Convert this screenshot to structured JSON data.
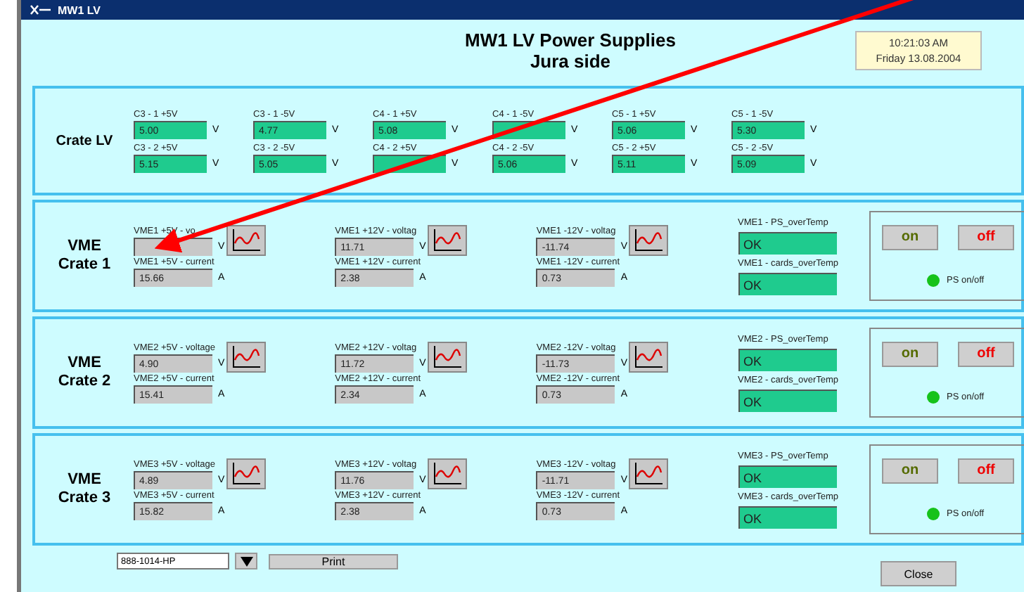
{
  "window": {
    "title": "MW1 LV"
  },
  "header": {
    "title": "MW1 LV Power Supplies",
    "subtitle": "Jura side",
    "time": "10:21:03 AM",
    "date": "Friday 13.08.2004"
  },
  "crate_lv": {
    "label": "Crate LV",
    "channels": [
      {
        "label": "C3 - 1 +5V",
        "value": "5.00",
        "unit": "V"
      },
      {
        "label": "C3 - 1 -5V",
        "value": "4.77",
        "unit": "V"
      },
      {
        "label": "C4 - 1 +5V",
        "value": "5.08",
        "unit": "V"
      },
      {
        "label": "C4 - 1 -5V",
        "unit": "V"
      },
      {
        "label": "C5 - 1 +5V",
        "value": "5.06",
        "unit": "V"
      },
      {
        "label": "C5 - 1 -5V",
        "value": "5.30",
        "unit": "V"
      },
      {
        "label": "C3 - 2 +5V",
        "value": "5.15",
        "unit": "V"
      },
      {
        "label": "C3 - 2 -5V",
        "value": "5.05",
        "unit": "V"
      },
      {
        "label": "C4 - 2 +5V",
        "unit": "V"
      },
      {
        "label": "C4 - 2 -5V",
        "value": "5.06",
        "unit": "V"
      },
      {
        "label": "C5 - 2 +5V",
        "value": "5.11",
        "unit": "V"
      },
      {
        "label": "C5 - 2 -5V",
        "value": "5.09",
        "unit": "V"
      }
    ]
  },
  "vme_crates": [
    {
      "label": "VME",
      "number": "Crate 1",
      "supplies": [
        {
          "voltage_label": "VME1 +5V - vo",
          "voltage_unit": "V",
          "current_label": "VME1 +5V - current",
          "current": "15.66",
          "current_unit": "A"
        },
        {
          "voltage_label": "VME1 +12V - voltag",
          "voltage": "11.71",
          "voltage_unit": "V",
          "current_label": "VME1 +12V - current",
          "current": "2.38",
          "current_unit": "A"
        },
        {
          "voltage_label": "VME1 -12V - voltag",
          "voltage": "-11.74",
          "voltage_unit": "V",
          "current_label": "VME1 -12V - current",
          "current": "0.73",
          "current_unit": "A"
        }
      ],
      "status": [
        {
          "label": "VME1 - PS_overTemp",
          "value": "OK"
        },
        {
          "label": "VME1 - cards_overTemp",
          "value": "OK"
        }
      ],
      "on_button": "on",
      "off_button": "off",
      "led_label": "PS on/off",
      "led_on": true
    },
    {
      "label": "VME",
      "number": "Crate 2",
      "supplies": [
        {
          "voltage_label": "VME2 +5V - voltage",
          "voltage": "4.90",
          "voltage_unit": "V",
          "current_label": "VME2 +5V - current",
          "current": "15.41",
          "current_unit": "A"
        },
        {
          "voltage_label": "VME2 +12V - voltag",
          "voltage": "11.72",
          "voltage_unit": "V",
          "current_label": "VME2 +12V - current",
          "current": "2.34",
          "current_unit": "A"
        },
        {
          "voltage_label": "VME2 -12V - voltag",
          "voltage": "-11.73",
          "voltage_unit": "V",
          "current_label": "VME2 -12V - current",
          "current": "0.73",
          "current_unit": "A"
        }
      ],
      "status": [
        {
          "label": "VME2 - PS_overTemp",
          "value": "OK"
        },
        {
          "label": "VME2 - cards_overTemp",
          "value": "OK"
        }
      ],
      "on_button": "on",
      "off_button": "off",
      "led_label": "PS on/off",
      "led_on": true
    },
    {
      "label": "VME",
      "number": "Crate 3",
      "supplies": [
        {
          "voltage_label": "VME3 +5V - voltage",
          "voltage": "4.89",
          "voltage_unit": "V",
          "current_label": "VME3 +5V - current",
          "current": "15.82",
          "current_unit": "A"
        },
        {
          "voltage_label": "VME3 +12V - voltag",
          "voltage": "11.76",
          "voltage_unit": "V",
          "current_label": "VME3 +12V - current",
          "current": "2.38",
          "current_unit": "A"
        },
        {
          "voltage_label": "VME3 -12V - voltag",
          "voltage": "-11.71",
          "voltage_unit": "V",
          "current_label": "VME3 -12V - current",
          "current": "0.73",
          "current_unit": "A"
        }
      ],
      "status": [
        {
          "label": "VME3 - PS_overTemp",
          "value": "OK"
        },
        {
          "label": "VME3 - cards_overTemp",
          "value": "OK"
        }
      ],
      "on_button": "on",
      "off_button": "off",
      "led_label": "PS on/off",
      "led_on": true
    }
  ],
  "footer": {
    "printer": "888-1014-HP",
    "print_button": "Print",
    "close_button": "Close"
  }
}
